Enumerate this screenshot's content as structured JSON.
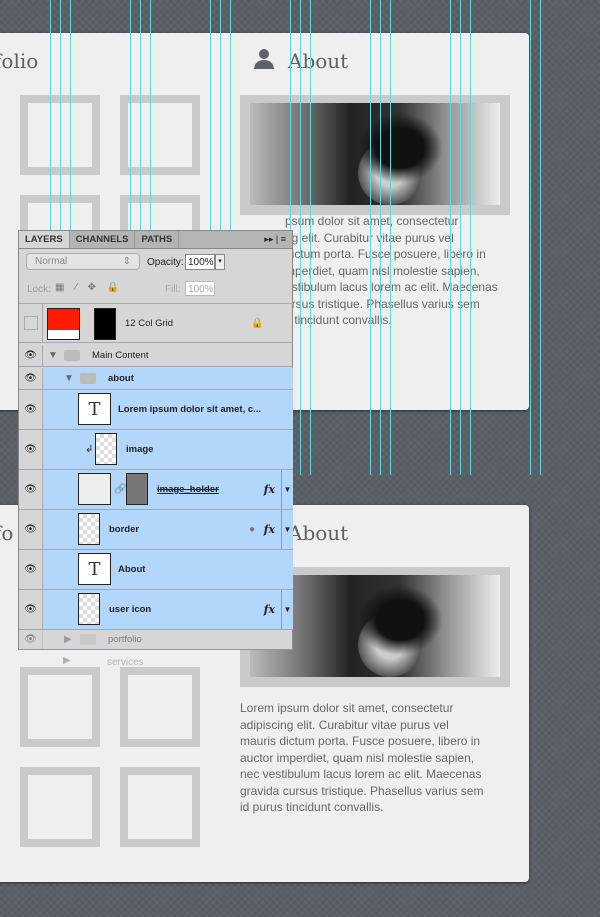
{
  "top": {
    "portfolio_heading": "folio",
    "about_heading": "About",
    "paragraph": [
      "psum dolor sit amet, consectetur",
      "ng elit. Curabitur vitae purus vel",
      "dictum porta. Fusce posuere, libero in",
      "mperdiet, quam nisl molestie sapien,",
      "estibulum lacus lorem ac elit. Maecenas",
      "ursus tristique. Phasellus varius sem",
      "s tincidunt convallis."
    ]
  },
  "bottom": {
    "portfolio_heading": "fo",
    "about_heading": "About",
    "paragraph": [
      "Lorem ipsum dolor sit amet, consectetur",
      "adipiscing elit. Curabitur vitae purus vel",
      "mauris dictum porta. Fusce posuere, libero in",
      "auctor imperdiet, quam nisl molestie sapien,",
      "nec vestibulum lacus lorem ac elit. Maecenas",
      "gravida cursus tristique. Phasellus varius sem",
      "id purus tincidunt convallis."
    ]
  },
  "panel": {
    "tabs": [
      "LAYERS",
      "CHANNELS",
      "PATHS"
    ],
    "blend_mode": "Normal",
    "opacity_label": "Opacity:",
    "opacity": "100%",
    "lock_label": "Lock:",
    "fill_label": "Fill:",
    "fill": "100%",
    "layers": [
      "12 Col Grid",
      "Main Content",
      "about",
      "Lorem ipsum dolor sit amet, c...",
      "image",
      "image_holder",
      "border",
      "About",
      "user icon",
      "portfolio",
      "services"
    ]
  },
  "colors": {
    "guide": "#5fd8e0",
    "selection": "#b3d6fb",
    "grid_swatch": "#ff1a00"
  }
}
